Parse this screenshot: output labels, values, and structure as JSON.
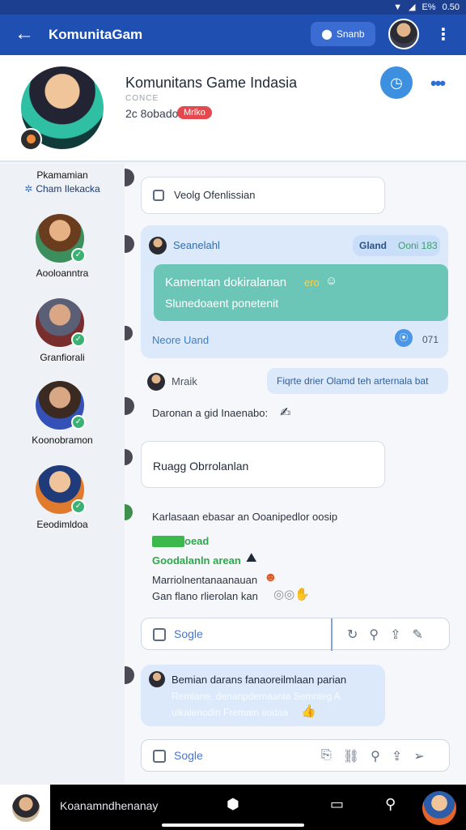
{
  "status_bar": {
    "time": "0.50",
    "battery": "E%"
  },
  "appbar": {
    "title": "KomunitaGam",
    "search_label": "Snanb"
  },
  "header": {
    "group_name": "Komunitans Game Indasia",
    "meta_small": "CONCE",
    "members_count": "2c 8obado",
    "status_pill": "Mrlko"
  },
  "sidebar": {
    "title_line1": "Pkamamian",
    "title_line2": "Cham Ilekacka",
    "members": [
      {
        "name": "Aooloanntra",
        "colors": [
          "#e6b185",
          "#6b3d1f",
          "#3c8f5c"
        ]
      },
      {
        "name": "Granfiorali",
        "colors": [
          "#d9a785",
          "#5a5f75",
          "#7a2d2d"
        ]
      },
      {
        "name": "Koonobramon",
        "colors": [
          "#d8a884",
          "#3a2a22",
          "#3451b8"
        ]
      },
      {
        "name": "Eeodimldoa",
        "colors": [
          "#efc39b",
          "#1f3b7a",
          "#e07a2d"
        ]
      }
    ]
  },
  "chat": {
    "msg1": "Veolg Ofenlissian",
    "card1": {
      "sender": "Seanelahl",
      "pill_label": "Gland",
      "pill_count": "Ooni 183",
      "teal_line1": "Kamentan dokiralanan",
      "teal_emoji_text": "ero",
      "teal_line2": "Slunedoaent ponetenit",
      "footer_label": "Neore Uand",
      "footer_count": "071"
    },
    "row_mark": {
      "name": "Mraik",
      "pill": "Fiqrte drier Olamd teh arternala bat"
    },
    "msg2": "Daronan a gid Inaenabo:",
    "msg3": "Ruagg Obrrolanlan",
    "block": {
      "line1": "Karlasaan ebasar an Ooanipedlor oosip",
      "green_bar_label": "oead",
      "green_line": "Goodalanln arean",
      "line3": "Marriolnentanaanauan",
      "line4": "Gan flano rlierolan kan"
    },
    "input1_placeholder": "Sogle",
    "card2": {
      "line1": "Bemian darans fanaoreilmlaan parian",
      "line2": "Remiane, denanpdemaania Semnleg A",
      "line3": "ulkalenodin Fremain sodaa"
    },
    "input2_placeholder": "Sogle"
  },
  "bottom_bar": {
    "label": "Koanamndhenanay"
  }
}
